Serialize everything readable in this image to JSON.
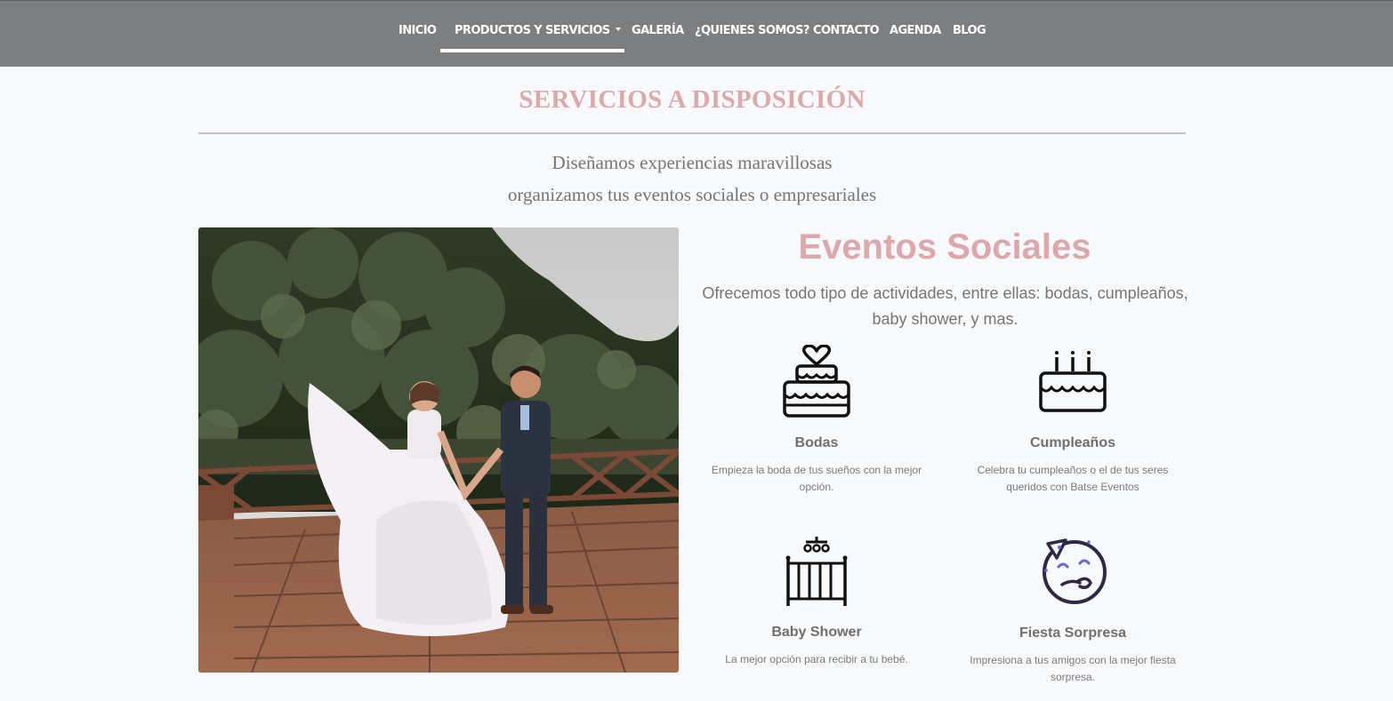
{
  "nav": {
    "items": [
      {
        "label": "INICIO"
      },
      {
        "label": "PRODUCTOS Y SERVICIOS",
        "active": true,
        "has_dropdown": true
      },
      {
        "label": "GALERÍA"
      },
      {
        "label": "¿QUIENES SOMOS?"
      },
      {
        "label": "CONTACTO"
      },
      {
        "label": "AGENDA"
      },
      {
        "label": "BLOG"
      }
    ]
  },
  "section": {
    "title": "SERVICIOS A DISPOSICIÓN",
    "subtitle_line1": "Diseñamos experiencias maravillosas",
    "subtitle_line2": "organizamos tus eventos sociales o empresariales"
  },
  "events": {
    "title": "Eventos Sociales",
    "description": "Ofrecemos todo tipo de actividades, entre ellas: bodas, cumpleaños, baby shower, y mas.",
    "services": [
      {
        "title": "Bodas",
        "text": "Empieza la boda de tus sueños con la mejor opción.",
        "icon": "wedding-cake-icon"
      },
      {
        "title": "Cumpleaños",
        "text": "Celebra tu cumpleaños o el de tus seres queridos con Batse Eventos",
        "icon": "birthday-cake-icon"
      },
      {
        "title": "Baby Shower",
        "text": "La mejor opción para recibir a tu bebé.",
        "icon": "crib-icon"
      },
      {
        "title": "Fiesta Sorpresa",
        "text": "Impresiona a tus amigos con la mejor fiesta sorpresa.",
        "icon": "party-face-icon"
      }
    ]
  },
  "colors": {
    "navbar_bg": "#7d7e80",
    "accent_pink": "#dba8ac",
    "text_gray": "#757575",
    "page_bg": "#f8f9fb"
  }
}
